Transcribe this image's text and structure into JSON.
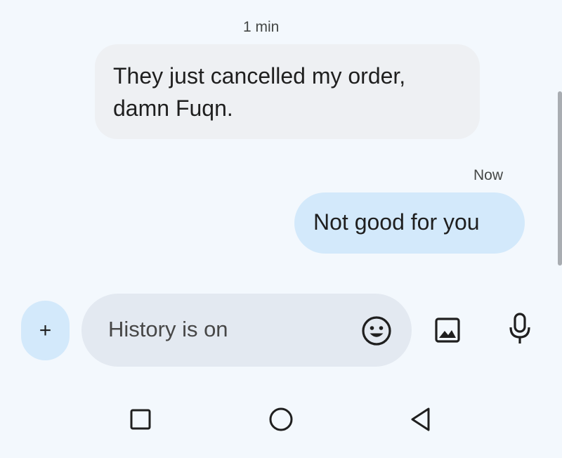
{
  "messages": [
    {
      "direction": "incoming",
      "time": "1 min",
      "lines": [
        "They just cancelled my order,",
        "damn Fuqn."
      ]
    },
    {
      "direction": "outgoing",
      "time": "Now",
      "lines": [
        "Not good for you"
      ]
    }
  ],
  "compose": {
    "add_label": "+",
    "placeholder": "History is on"
  },
  "icons": {
    "add": "plus-icon",
    "emoji": "emoji-icon",
    "gallery": "image-icon",
    "mic": "microphone-icon",
    "nav_recents": "square-icon",
    "nav_home": "circle-icon",
    "nav_back": "triangle-back-icon"
  },
  "colors": {
    "background": "#f3f8fd",
    "incoming_bubble": "#eef0f3",
    "outgoing_bubble": "#d3e9fb",
    "input_box": "#e3e9f1"
  }
}
